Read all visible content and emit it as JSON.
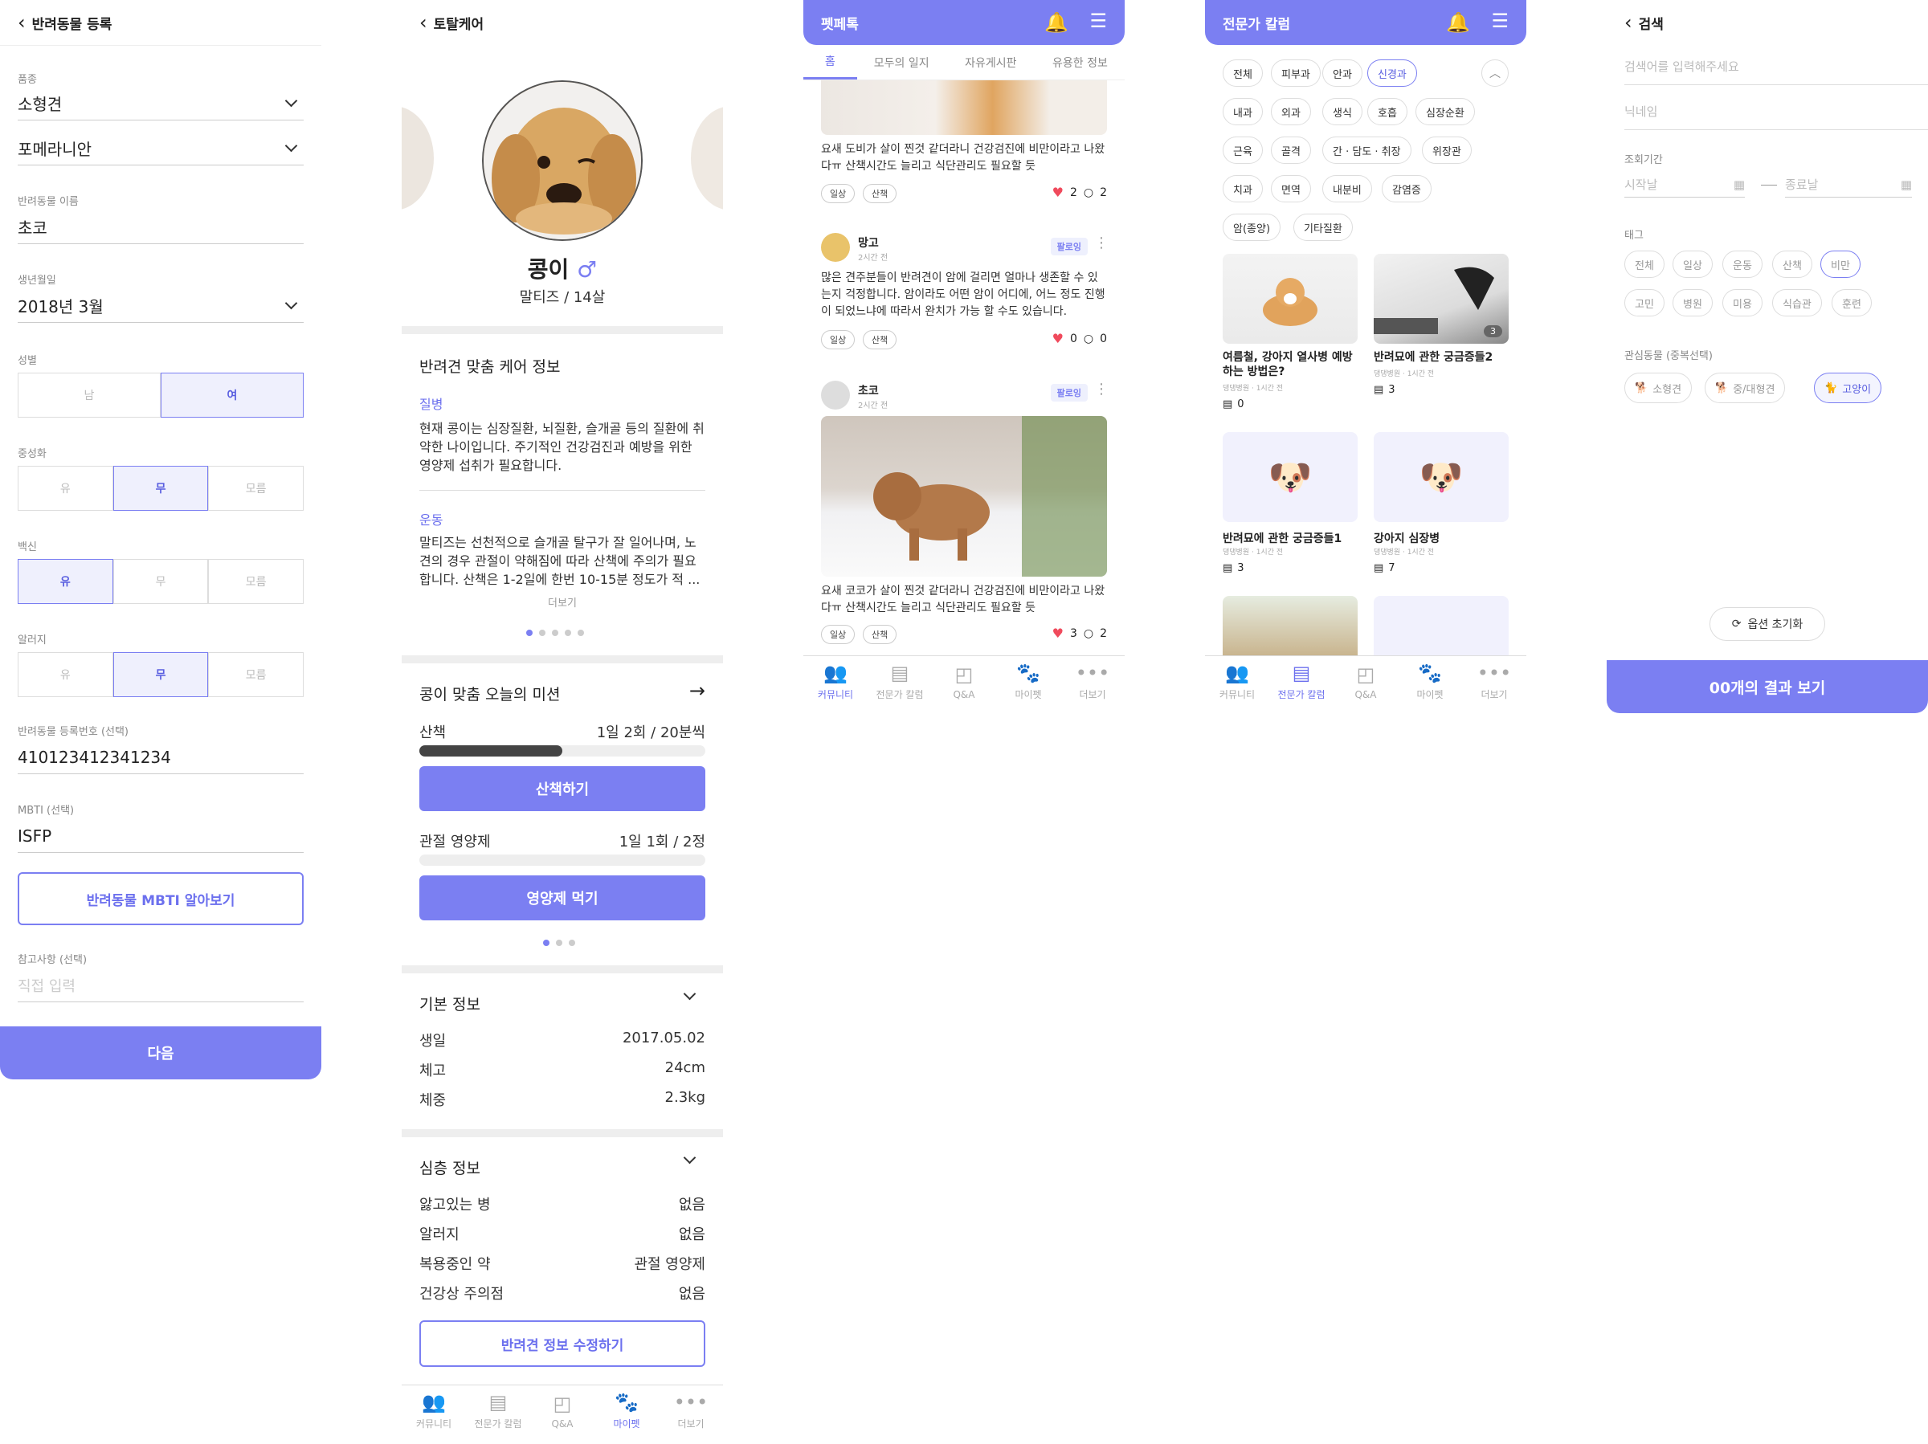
{
  "s1": {
    "title": "반려동물 등록",
    "breed_label": "품종",
    "breed1": "소형견",
    "breed2": "포메라니안",
    "name_label": "반려동물 이름",
    "name": "초코",
    "birth_label": "생년월일",
    "birth": "2018년  3월",
    "sex_label": "성별",
    "sex": [
      "남",
      "여"
    ],
    "neuter_label": "중성화",
    "neuter": [
      "유",
      "무",
      "모름"
    ],
    "vaccine_label": "백신",
    "vaccine": [
      "유",
      "무",
      "모름"
    ],
    "allergy_label": "알러지",
    "allergy": [
      "유",
      "무",
      "모름"
    ],
    "reg_label": "반려동물 등록번호 (선택)",
    "reg": "410123412341234",
    "mbti_label": "MBTI (선택)",
    "mbti": "ISFP",
    "mbti_btn": "반려동물 MBTI 알아보기",
    "note_label": "참고사항 (선택)",
    "note_placeholder": "직접 입력",
    "next": "다음"
  },
  "s2": {
    "title": "토탈케어",
    "pet_name": "콩이",
    "sex_symbol": "♂",
    "pet_sub": "말티즈 / 14살",
    "care_title": "반려견 맞춤 케어 정보",
    "disease_h": "질병",
    "disease_t": "현재 콩이는 심장질환, 뇌질환, 슬개골 등의 질환에 취약한 나이입니다. 주기적인 건강검진과 예방을 위한 영양제 섭취가 필요합니다.",
    "exercise_h": "운동",
    "exercise_t": "말티즈는 선천적으로 슬개골 탈구가 잘 일어나며, 노견의 경우 관절이 약해짐에 따라 산책에 주의가 필요합니다. 산책은 1-2일에 한번 10-15분 정도가 적 ...",
    "more": "더보기",
    "mission_title": "콩이 맞춤 오늘의 미션",
    "m1_name": "산책",
    "m1_val": "1일 2회 / 20분씩",
    "m1_progress": 0.5,
    "m1_btn": "산책하기",
    "m2_name": "관절 영양제",
    "m2_val": "1일 1회 / 2정",
    "m2_progress": 0,
    "m2_btn": "영양제 먹기",
    "basic_title": "기본 정보",
    "basic": [
      {
        "k": "생일",
        "v": "2017.05.02"
      },
      {
        "k": "체고",
        "v": "24cm"
      },
      {
        "k": "체중",
        "v": "2.3kg"
      }
    ],
    "deep_title": "심층 정보",
    "deep": [
      {
        "k": "앓고있는 병",
        "v": "없음"
      },
      {
        "k": "알러지",
        "v": "없음"
      },
      {
        "k": "복용중인 약",
        "v": "관절 영양제"
      },
      {
        "k": "건강상 주의점",
        "v": "없음"
      }
    ],
    "edit_btn": "반려견 정보 수정하기"
  },
  "nav": {
    "community": "커뮤니티",
    "column": "전문가 칼럼",
    "qa": "Q&A",
    "mypet": "마이펫",
    "more": "더보기"
  },
  "s3": {
    "title": "펫페톡",
    "tabs": [
      "홈",
      "모두의 일지",
      "자유게시판",
      "유용한 정보"
    ],
    "p1_text": "요새 도비가 살이 찐것 같더라니 건강검진에 비만이라고 나왔다ㅠ 산책시간도 늘리고 식단관리도 필요할 듯",
    "p1_tags": [
      "일상",
      "산책"
    ],
    "p1_likes": "2",
    "p1_comments": "2",
    "p2_user": "망고",
    "p2_time": "2시간 전",
    "p2_follow": "팔로잉",
    "p2_text": "많은 견주분들이 반려견이 암에 걸리면 얼마나 생존할 수 있는지 걱정합니다. 암이라도 어떤 암이 어디에, 어느 정도 진행이 되었느냐에 따라서 완치가 가능 할 수도 있습니다.",
    "p2_tags": [
      "일상",
      "산책"
    ],
    "p2_likes": "0",
    "p2_comments": "0",
    "p3_user": "초코",
    "p3_time": "2시간 전",
    "p3_follow": "팔로잉",
    "p3_text": "요새 코코가 살이 찐것 같더라니 건강검진에 비만이라고 나왔다ㅠ 산책시간도 늘리고 식단관리도 필요할 듯",
    "p3_tags": [
      "일상",
      "산책"
    ],
    "p3_likes": "3",
    "p3_comments": "2"
  },
  "s4": {
    "title": "전문가 칼럼",
    "chips": [
      "전체",
      "피부과",
      "안과",
      "신경과",
      "내과",
      "외과",
      "생식",
      "호흡",
      "심장순환",
      "근육",
      "골격",
      "간 · 담도 · 취장",
      "위장관",
      "치과",
      "면역",
      "내분비",
      "감염증",
      "암(종양)",
      "기타질환"
    ],
    "cards": [
      {
        "title": "여름철, 강아지 열사병 예방하는 방법은?",
        "meta": "댕댕병원 · 1시간 전",
        "count": "0"
      },
      {
        "title": "반려묘에 관한 궁금증들2",
        "meta": "댕댕병원 · 1시간 전",
        "count": "3",
        "badge": "3"
      },
      {
        "title": "반려묘에 관한 궁금증들1",
        "meta": "댕댕병원 · 1시간 전",
        "count": "3"
      },
      {
        "title": "강아지 심장병",
        "meta": "댕댕병원 · 1시간 전",
        "count": "7"
      }
    ]
  },
  "s5": {
    "title": "검색",
    "search_placeholder": "검색어를 입력해주세요",
    "nick_placeholder": "닉네임",
    "period_label": "조회기간",
    "start": "시작날",
    "end": "종료날",
    "tag_label": "태그",
    "tags": [
      "전체",
      "일상",
      "운동",
      "산책",
      "비만",
      "고민",
      "병원",
      "미용",
      "식습관",
      "훈련"
    ],
    "interest_label": "관심동물 (중복선택)",
    "animals": [
      "소형견",
      "중/대형견",
      "고양이"
    ],
    "reset": "옵션 초기화",
    "result": "00개의 결과 보기"
  },
  "colors": {
    "accent": "#7b7ff2",
    "heart": "#f04a5c"
  }
}
